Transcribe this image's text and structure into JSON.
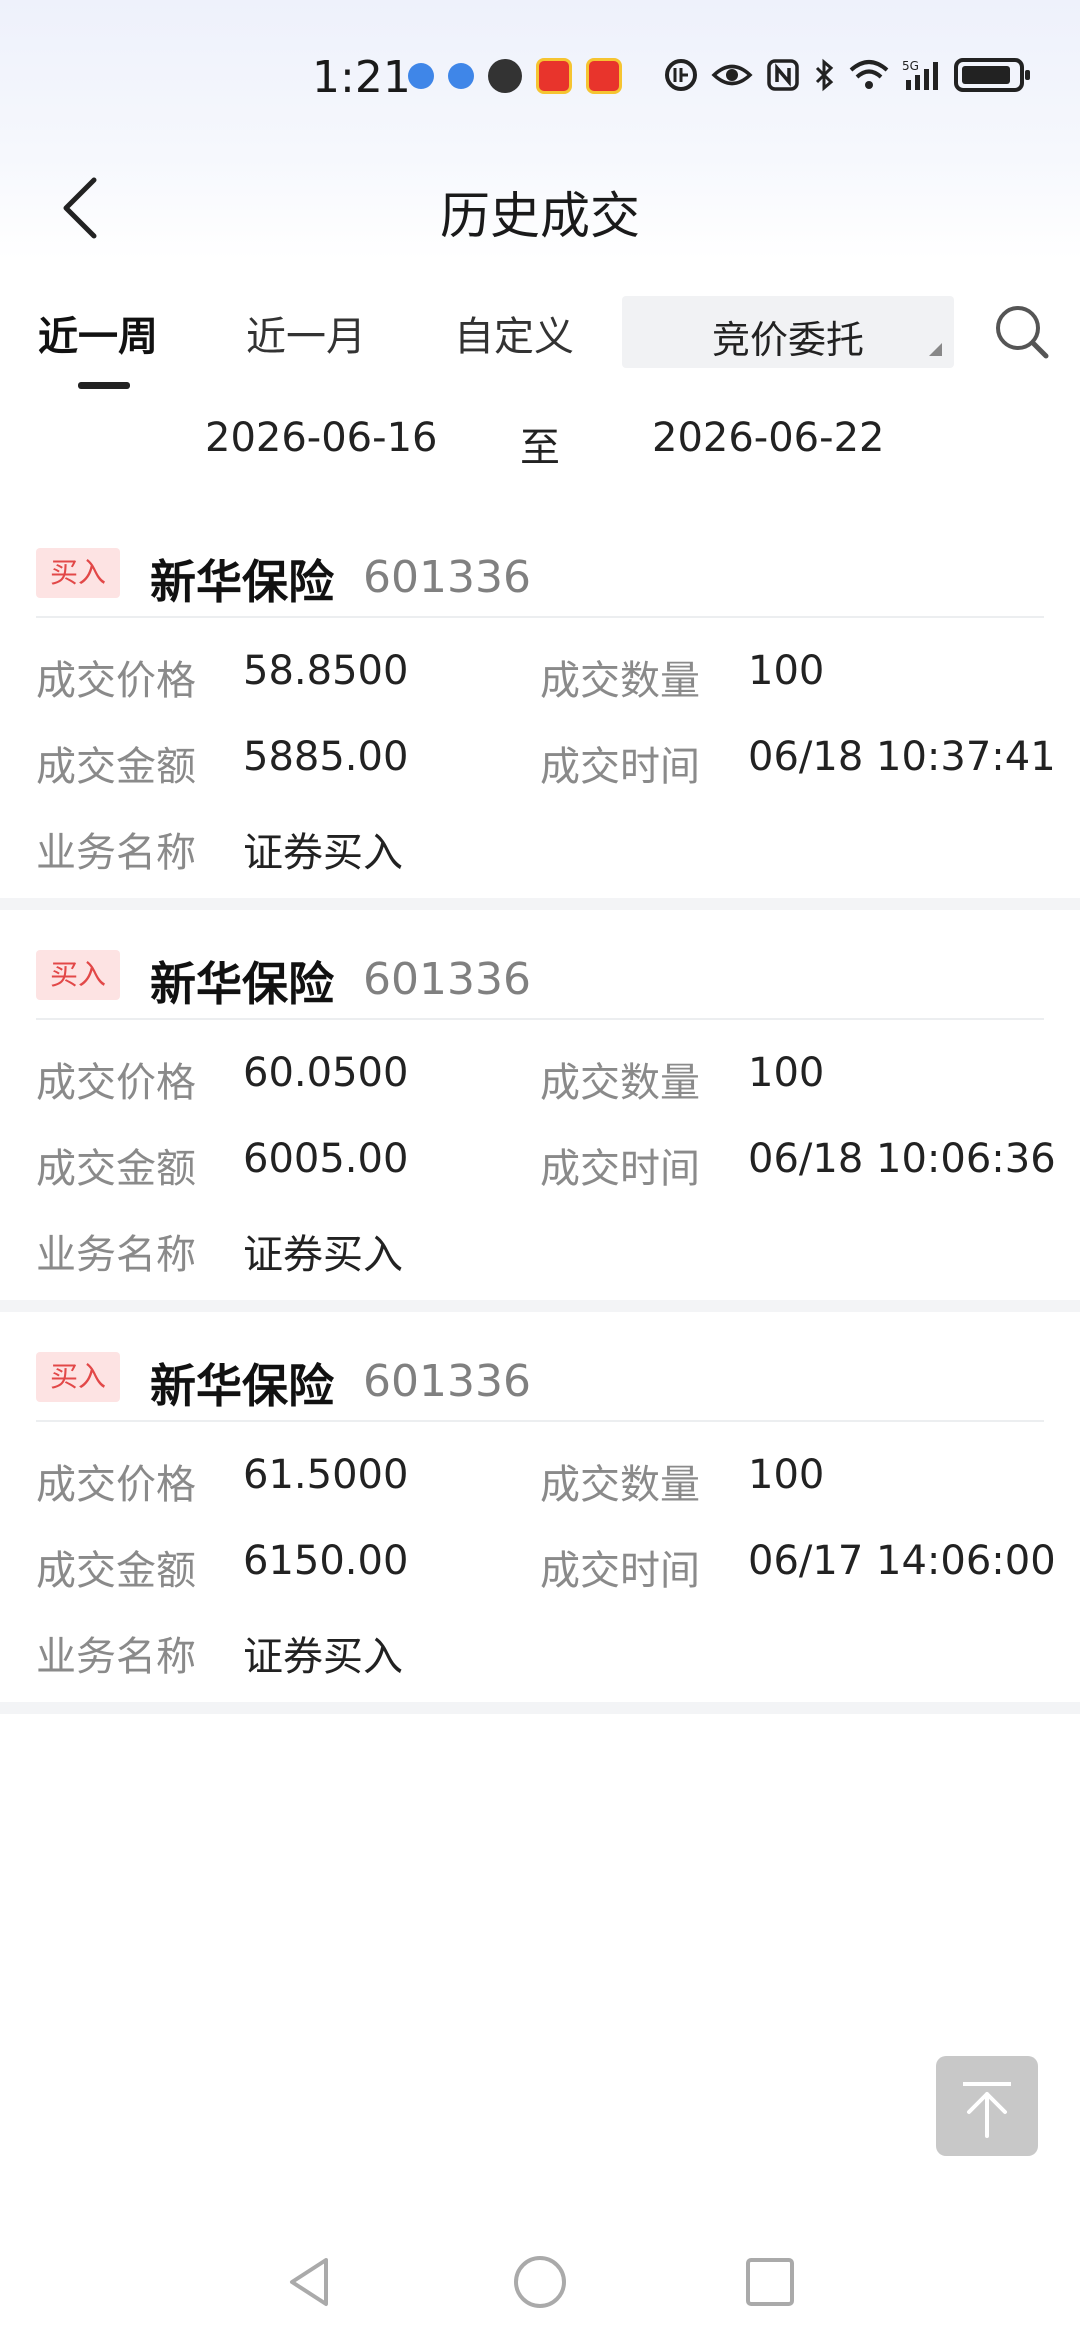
{
  "status_bar": {
    "time": "1:21",
    "network": "5G"
  },
  "header": {
    "title": "历史成交"
  },
  "tabs": [
    {
      "label": "近一周",
      "active": true
    },
    {
      "label": "近一月",
      "active": false
    },
    {
      "label": "自定义",
      "active": false
    }
  ],
  "filter": {
    "selected": "竞价委托"
  },
  "date_range": {
    "start": "2026-06-16",
    "separator": "至",
    "end": "2026-06-22"
  },
  "labels": {
    "price": "成交价格",
    "quantity": "成交数量",
    "amount": "成交金额",
    "time": "成交时间",
    "business": "业务名称"
  },
  "records": [
    {
      "badge": "买入",
      "name": "新华保险",
      "code": "601336",
      "price": "58.8500",
      "quantity": "100",
      "amount": "5885.00",
      "time": "06/18 10:37:41",
      "business": "证券买入"
    },
    {
      "badge": "买入",
      "name": "新华保险",
      "code": "601336",
      "price": "60.0500",
      "quantity": "100",
      "amount": "6005.00",
      "time": "06/18 10:06:36",
      "business": "证券买入"
    },
    {
      "badge": "买入",
      "name": "新华保险",
      "code": "601336",
      "price": "61.5000",
      "quantity": "100",
      "amount": "6150.00",
      "time": "06/17 14:06:00",
      "business": "证券买入"
    }
  ],
  "colors": {
    "badge_bg": "#fde3e3",
    "badge_text": "#e24848",
    "label_gray": "#8a8a8a"
  }
}
